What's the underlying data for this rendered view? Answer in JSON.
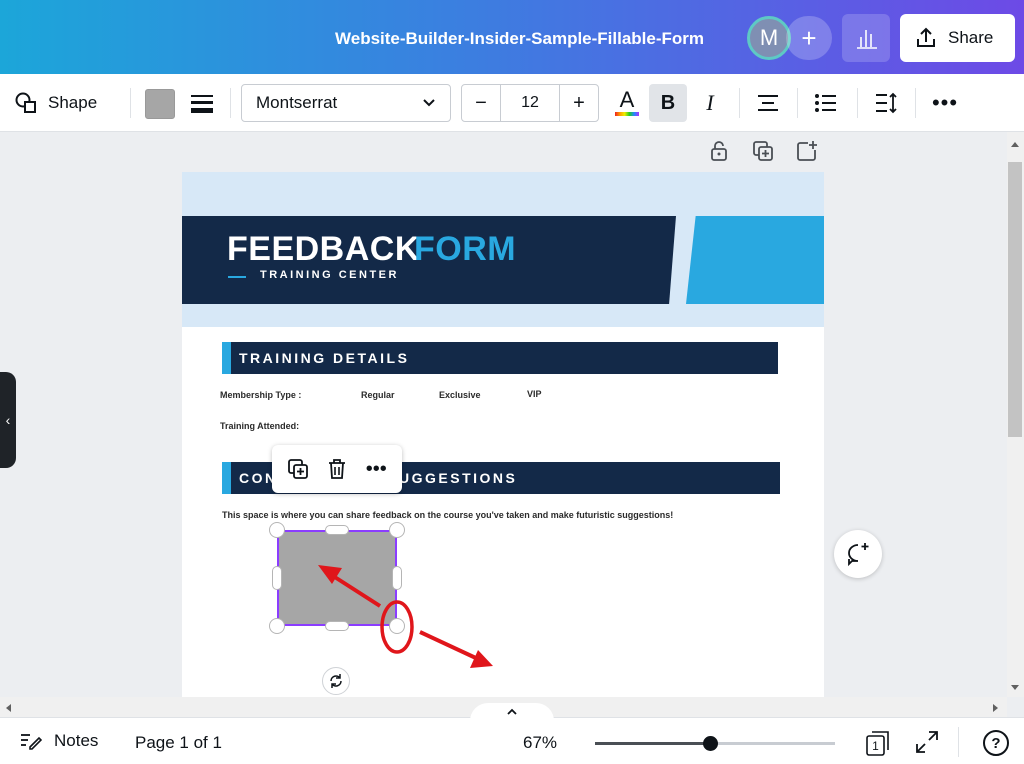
{
  "header": {
    "doc_title": "Website-Builder-Insider-Sample-Fillable-Form",
    "avatar_initial": "M",
    "add_label": "+",
    "share_label": "Share",
    "icons": [
      "user-avatar",
      "plus-icon",
      "insights-icon",
      "share-upload-icon"
    ]
  },
  "toolbar": {
    "shape_label": "Shape",
    "fill_color": "#a6a6a6",
    "font": "Montserrat",
    "size_minus": "−",
    "font_size": "12",
    "size_plus": "+",
    "text_color_glyph": "A",
    "bold_glyph": "B",
    "italic_glyph": "I",
    "more_glyph": "•••"
  },
  "document": {
    "title_part1": "FEEDBACK",
    "title_part2": "FORM",
    "subtitle": "TRAINING CENTER",
    "section1": "TRAINING DETAILS",
    "membership_label": "Membership Type :",
    "options": [
      "Regular",
      "Exclusive",
      "VIP"
    ],
    "training_attended": "Training Attended:",
    "section2": "COMMENTS & SUGGESTIONS",
    "section2_visible_left": "CON",
    "section2_visible_right": "UGGESTIONS",
    "description": "This space is where you can share feedback on the course you've taken and make futuristic suggestions!",
    "colors": {
      "navy": "#132948",
      "blue": "#29a8e0",
      "light_bg": "#d7e8f7"
    }
  },
  "context_menu": {
    "more_glyph": "•••",
    "icons": [
      "duplicate-icon",
      "trash-icon",
      "more-icon"
    ]
  },
  "footer": {
    "notes_label": "Notes",
    "page_label": "Page 1 of 1",
    "zoom": "67%",
    "zoom_fraction": 0.48,
    "pages_count": "1",
    "help_glyph": "?"
  },
  "annotation_color": "#e0161b"
}
